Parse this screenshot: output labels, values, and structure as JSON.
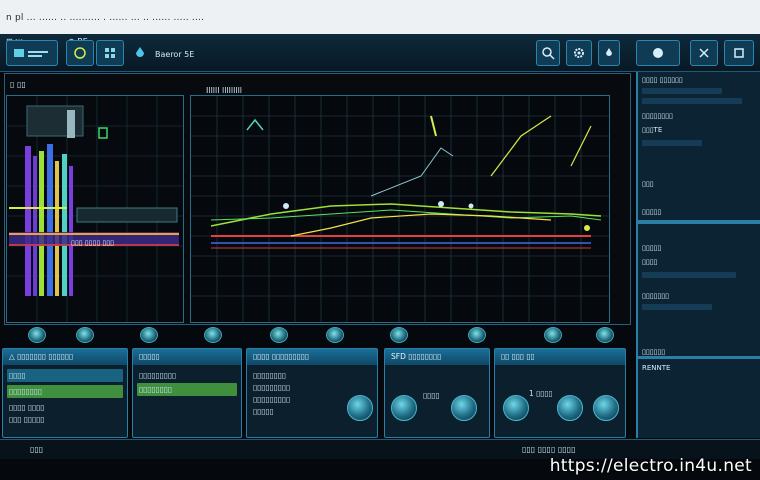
{
  "window": {
    "title": "n pl ... ...... .. .......... . ...... ... .. ...... ..... ....",
    "toolbar_left_text": "⊞ ⬚",
    "toolbar_mid_text": "⊕ BE",
    "toolbar_label": "Baeror 5E",
    "icons": [
      "search-icon",
      "gear-icon",
      "grid-icon",
      "chevron-right-icon"
    ]
  },
  "plot_header": {
    "left_title": "▯ ▯▯",
    "right_title": "Illlll lllllllll"
  },
  "left_plot_label": "▯▯▯ ▯▯▯▯ ▯▯▯",
  "sidebar": {
    "title": "▯▯▯▯ ▯▯▯▯▯▯",
    "sections": [
      "▯▯▯▯▯▯▯▯",
      "▯▯▯TE",
      "▯▯▯",
      "▯▯▯▯▯",
      "▯▯▯▯▯",
      "▯▯▯▯",
      "▯▯▯▯▯▯▯",
      "▯▯▯▯▯▯",
      "RENNTE"
    ]
  },
  "cards": [
    {
      "head": "△ ▯▯▯▯▯▯▯ ▯▯▯▯▯▯",
      "line1": "▯▯▯▯",
      "line2": "▯▯▯▯▯▯▯▯",
      "line3": "▯▯▯▯ ▯▯▯▯",
      "line4": "▯▯▯ ▯▯▯▯▯"
    },
    {
      "head": "▯▯▯▯▯",
      "line1": "▯▯▯▯▯▯▯▯▯",
      "line2": "▯▯▯▯▯▯▯▯",
      "line3": "",
      "line4": ""
    },
    {
      "head": "▯▯▯▯ ▯▯▯▯▯▯▯▯▯",
      "line1": "▯▯▯▯▯▯▯▯",
      "line2": "▯▯▯▯▯▯▯▯▯",
      "line3": "▯▯▯▯▯▯▯▯▯",
      "line4": "▯▯▯▯▯"
    },
    {
      "head": "SFD ▯▯▯▯▯▯▯▯",
      "line1": "▯▯▯▯",
      "line2": "",
      "line3": "",
      "line4": ""
    },
    {
      "head": "▯▯ ▯▯▯ ▯▯",
      "line1": "1 ▯▯▯▯",
      "line2": "",
      "line3": "",
      "line4": ""
    }
  ],
  "status": {
    "left": "▯▯▯",
    "right": "▯▯▯ ▯▯▯▯ ▯▯▯▯"
  },
  "watermark": "https://electro.in4u.net",
  "colors": {
    "accent": "#2a7fa6",
    "trace_green": "#9ee03a",
    "trace_red": "#e2413f",
    "trace_yellow": "#f2e247",
    "trace_purple": "#7a3de0",
    "trace_blue": "#3b6fe3"
  }
}
